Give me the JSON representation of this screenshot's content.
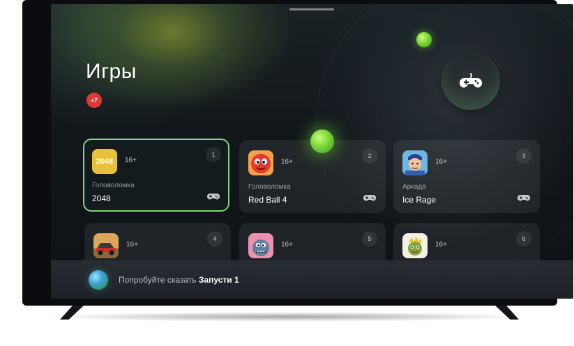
{
  "page": {
    "title": "Игры",
    "badge": "+7"
  },
  "games": [
    {
      "rank": "1",
      "age": "16+",
      "genre": "Головоломка",
      "name": "2048",
      "thumb_text": "2048",
      "icon": "2048-tile-icon",
      "focused": true
    },
    {
      "rank": "2",
      "age": "16+",
      "genre": "Головоломка",
      "name": "Red Ball 4",
      "icon": "red-ball-icon"
    },
    {
      "rank": "3",
      "age": "16+",
      "genre": "Аркада",
      "name": "Ice Rage",
      "icon": "hockey-player-icon"
    },
    {
      "rank": "4",
      "age": "16+",
      "icon": "race-car-icon"
    },
    {
      "rank": "5",
      "age": "16+",
      "icon": "monster-icon"
    },
    {
      "rank": "6",
      "age": "16+",
      "icon": "cartoon-character-icon"
    }
  ],
  "hint": {
    "prefix": "Попробуйте сказать",
    "command": "Запусти 1"
  },
  "colors": {
    "accent_green": "#7ed47c",
    "badge_red": "#e03838",
    "tile_2048": "#e8c13a"
  }
}
